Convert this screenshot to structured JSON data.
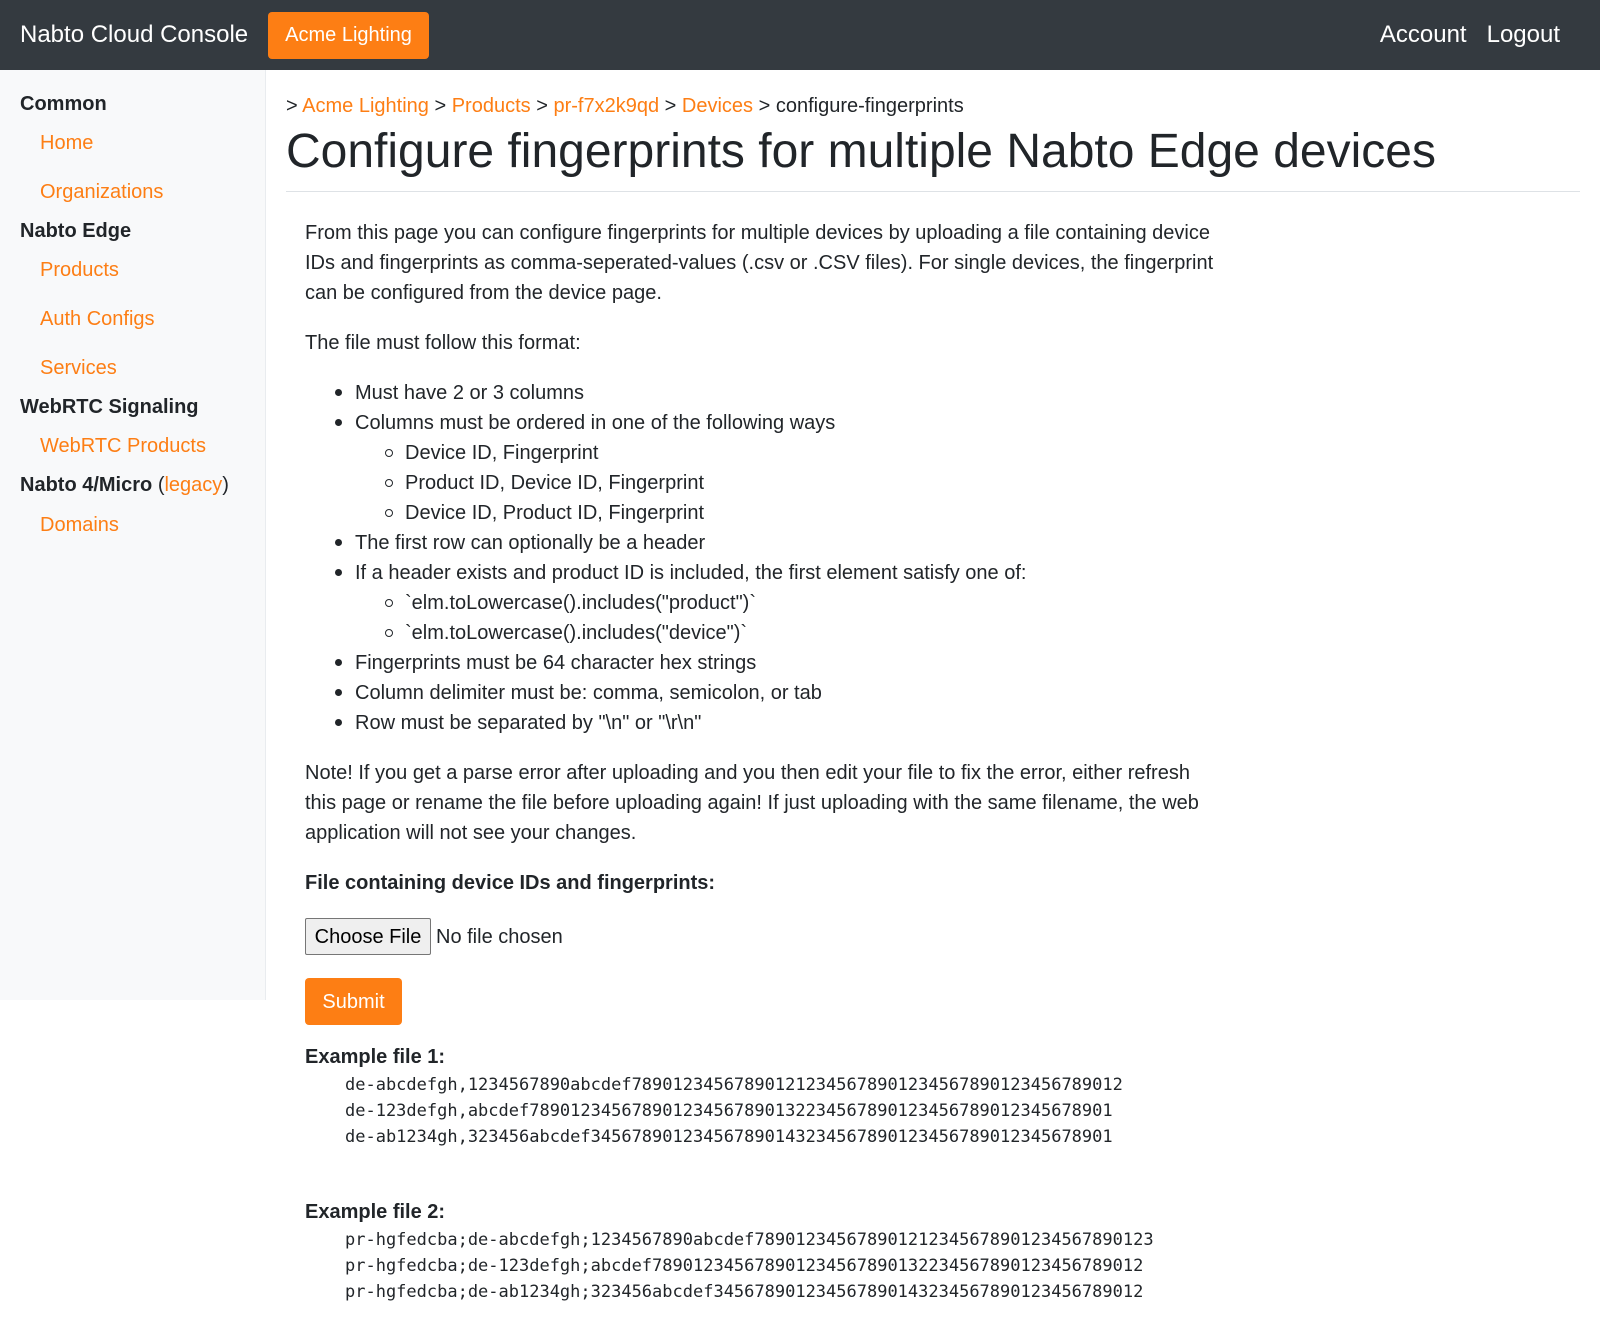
{
  "navbar": {
    "brand": "Nabto Cloud Console",
    "org_button": "Acme Lighting",
    "account": "Account",
    "logout": "Logout"
  },
  "sidebar": {
    "common": "Common",
    "home": "Home",
    "organizations": "Organizations",
    "nabto_edge": "Nabto Edge",
    "products": "Products",
    "auth_configs": "Auth Configs",
    "services": "Services",
    "webrtc_signaling": "WebRTC Signaling",
    "webrtc_products": "WebRTC Products",
    "nabto4_micro": "Nabto 4/Micro",
    "open_paren": "(",
    "legacy": "legacy",
    "close_paren": ")",
    "domains": "Domains"
  },
  "breadcrumb": {
    "sep": ">",
    "items": [
      "Acme Lighting",
      "Products",
      "pr-f7x2k9qd",
      "Devices"
    ],
    "current": "configure-fingerprints"
  },
  "page": {
    "title": "Configure fingerprints for multiple Nabto Edge devices",
    "intro": "From this page you can configure fingerprints for multiple devices by uploading a file containing device IDs and fingerprints as comma-seperated-values (.csv or .CSV files). For single devices, the fingerprint can be configured from the device page.",
    "format_intro": "The file must follow this format:",
    "rules": {
      "r1": "Must have 2 or 3 columns",
      "r2": "Columns must be ordered in one of the following ways",
      "r2a": "Device ID, Fingerprint",
      "r2b": "Product ID, Device ID, Fingerprint",
      "r2c": "Device ID, Product ID, Fingerprint",
      "r3": "The first row can optionally be a header",
      "r4": "If a header exists and product ID is included, the first element satisfy one of:",
      "r4a": "`elm.toLowercase().includes(\"product\")`",
      "r4b": "`elm.toLowercase().includes(\"device\")`",
      "r5": "Fingerprints must be 64 character hex strings",
      "r6": "Column delimiter must be: comma, semicolon, or tab",
      "r7": "Row must be separated by \"\\n\" or \"\\r\\n\""
    },
    "note": "Note! If you get a parse error after uploading and you then edit your file to fix the error, either refresh this page or rename the file before uploading again! If just uploading with the same filename, the web application will not see your changes.",
    "file_label": "File containing device IDs and fingerprints:",
    "choose_file": "Choose File",
    "no_file": "No file chosen",
    "submit": "Submit",
    "example1_title": "Example file 1:",
    "example1_lines": [
      "de-abcdefgh,1234567890abcdef789012345678901212345678901234567890123456789012",
      "de-123defgh,abcdef789012345678901234567890132234567890123456789012345678901",
      "de-ab1234gh,323456abcdef345678901234567890143234567890123456789012345678901"
    ],
    "example2_title": "Example file 2:",
    "example2_lines": [
      "pr-hgfedcba;de-abcdefgh;1234567890abcdef789012345678901212345678901234567890123",
      "pr-hgfedcba;de-123defgh;abcdef789012345678901234567890132234567890123456789012",
      "pr-hgfedcba;de-ab1234gh;323456abcdef345678901234567890143234567890123456789012"
    ]
  }
}
